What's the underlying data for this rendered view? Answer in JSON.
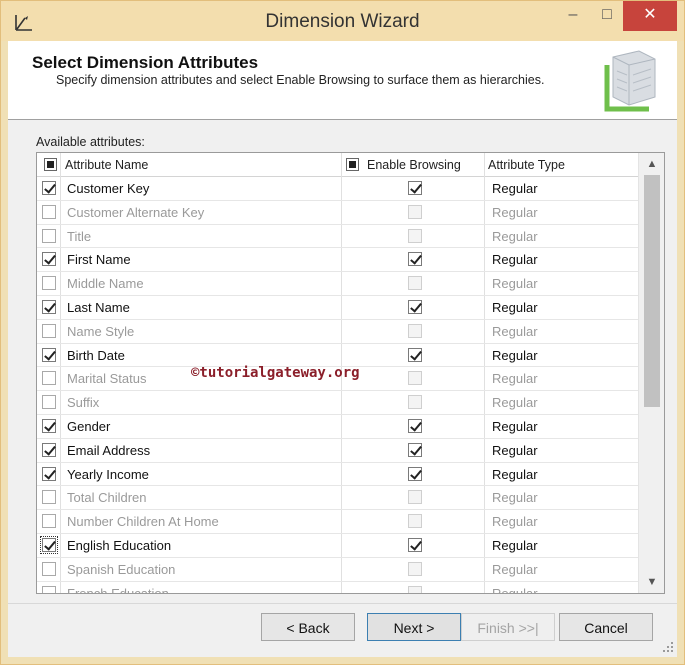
{
  "window": {
    "title": "Dimension Wizard",
    "minimize_label": "–",
    "maximize_label": "□",
    "close_label": "✕"
  },
  "header": {
    "title": "Select Dimension Attributes",
    "subtitle": "Specify dimension attributes and select Enable Browsing to surface them as hierarchies."
  },
  "attributes_label": "Available attributes:",
  "columns": {
    "name": "Attribute Name",
    "browsing": "Enable Browsing",
    "type": "Attribute Type"
  },
  "rows": [
    {
      "name": "Customer Key",
      "checked": true,
      "browsing": true,
      "type": "Regular"
    },
    {
      "name": "Customer Alternate Key",
      "checked": false,
      "browsing": false,
      "type": "Regular"
    },
    {
      "name": "Title",
      "checked": false,
      "browsing": false,
      "type": "Regular"
    },
    {
      "name": "First Name",
      "checked": true,
      "browsing": true,
      "type": "Regular"
    },
    {
      "name": "Middle Name",
      "checked": false,
      "browsing": false,
      "type": "Regular"
    },
    {
      "name": "Last Name",
      "checked": true,
      "browsing": true,
      "type": "Regular"
    },
    {
      "name": "Name Style",
      "checked": false,
      "browsing": false,
      "type": "Regular"
    },
    {
      "name": "Birth Date",
      "checked": true,
      "browsing": true,
      "type": "Regular"
    },
    {
      "name": "Marital Status",
      "checked": false,
      "browsing": false,
      "type": "Regular"
    },
    {
      "name": "Suffix",
      "checked": false,
      "browsing": false,
      "type": "Regular"
    },
    {
      "name": "Gender",
      "checked": true,
      "browsing": true,
      "type": "Regular"
    },
    {
      "name": "Email Address",
      "checked": true,
      "browsing": true,
      "type": "Regular"
    },
    {
      "name": "Yearly Income",
      "checked": true,
      "browsing": true,
      "type": "Regular"
    },
    {
      "name": "Total Children",
      "checked": false,
      "browsing": false,
      "type": "Regular"
    },
    {
      "name": "Number Children At Home",
      "checked": false,
      "browsing": false,
      "type": "Regular"
    },
    {
      "name": "English Education",
      "checked": true,
      "browsing": true,
      "type": "Regular",
      "focused": true
    },
    {
      "name": "Spanish Education",
      "checked": false,
      "browsing": false,
      "type": "Regular"
    },
    {
      "name": "French Education",
      "checked": false,
      "browsing": false,
      "type": "Regular"
    }
  ],
  "watermark": "©tutorialgateway.org",
  "buttons": {
    "back": "< Back",
    "next": "Next >",
    "finish": "Finish >>|",
    "cancel": "Cancel"
  },
  "icons": {
    "wizard": "wizard-icon",
    "dimension": "dimension-cube-icon",
    "scroll_up": "chevron-up-icon",
    "scroll_down": "chevron-down-icon",
    "grip": "resize-grip-icon"
  }
}
